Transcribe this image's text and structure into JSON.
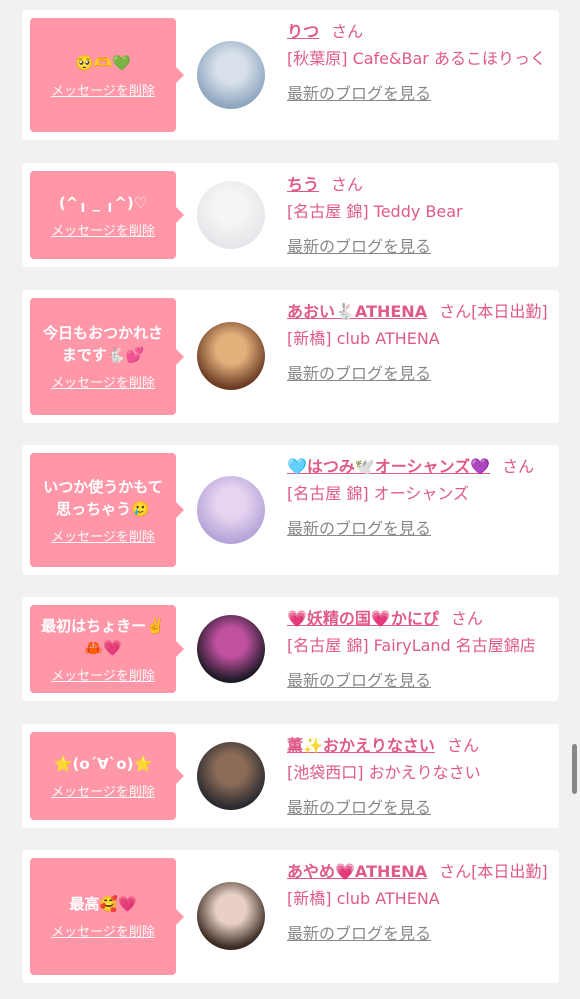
{
  "common": {
    "honorific": "さん",
    "delete_label": "メッセージを削除",
    "blog_label": "最新のブログを見る"
  },
  "cards": [
    {
      "message": "🥺🫶💚",
      "name": "りつ",
      "status": "",
      "shop": "[秋葉原] Cafe&Bar あるこほりっく",
      "avatar_colors": [
        "#8ea6c0",
        "#d8e0ea"
      ]
    },
    {
      "message": "(^╻ _ ╻^)♡",
      "name": "ちう",
      "status": "",
      "shop": "[名古屋 錦] Teddy Bear",
      "avatar_colors": [
        "#e6e6ea",
        "#f7f4f4"
      ]
    },
    {
      "message": "今日もおつかれさまです🐇💕",
      "name": "あおい🐇ATHENA",
      "status": "[本日出勤]",
      "shop": "[新橋] club ATHENA",
      "avatar_colors": [
        "#6b3c24",
        "#e3b07c"
      ]
    },
    {
      "message": "いつか使うかもて思っちゃう🥲",
      "name": "🩵はつみ🕊️オーシャンズ💜",
      "status": "",
      "shop": "[名古屋 錦] オーシャンズ",
      "avatar_colors": [
        "#b4a4d8",
        "#e6d4f0"
      ]
    },
    {
      "message": "最初はちょきー✌️🦀💗",
      "name": "💗妖精の国💗かにぴ",
      "status": "",
      "shop": "[名古屋 錦] FairyLand 名古屋錦店",
      "avatar_colors": [
        "#1e1a26",
        "#c050a0"
      ]
    },
    {
      "message": "⭐️(o´∀`o)⭐️",
      "name": "薫✨おかえりなさい",
      "status": "",
      "shop": "[池袋西口] おかえりなさい",
      "avatar_colors": [
        "#2a2a30",
        "#8c6c58"
      ]
    },
    {
      "message": "最高🥰💗",
      "name": "あやめ💗ATHENA",
      "status": "[本日出勤]",
      "shop": "[新橋] club ATHENA",
      "avatar_colors": [
        "#3a2a22",
        "#e8d0c4"
      ]
    }
  ]
}
